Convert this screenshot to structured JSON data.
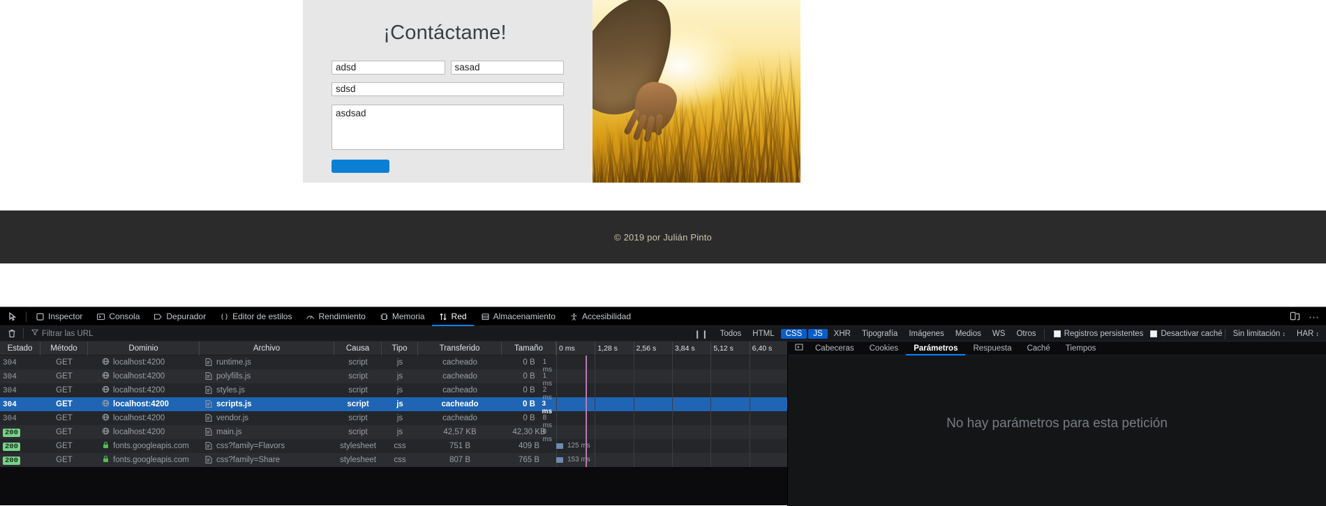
{
  "page": {
    "contact": {
      "title": "¡Contáctame!",
      "name_value": "adsd",
      "surname_value": "sasad",
      "subject_value": "sdsd",
      "message_value": "asdsad",
      "submit_label": "",
      "accent_color": "#0a7fd4",
      "card_bg": "#e7e7e7"
    },
    "footer": {
      "copyright": "© 2019 por Julián Pinto"
    }
  },
  "devtools": {
    "tabs": [
      {
        "label": "Inspector",
        "icon": "inspector-icon",
        "active": false
      },
      {
        "label": "Consola",
        "icon": "console-icon",
        "active": false
      },
      {
        "label": "Depurador",
        "icon": "debugger-icon",
        "active": false
      },
      {
        "label": "Editor de estilos",
        "icon": "style-editor-icon",
        "active": false
      },
      {
        "label": "Rendimiento",
        "icon": "performance-icon",
        "active": false
      },
      {
        "label": "Memoria",
        "icon": "memory-icon",
        "active": false
      },
      {
        "label": "Red",
        "icon": "network-icon",
        "active": true
      },
      {
        "label": "Almacenamiento",
        "icon": "storage-icon",
        "active": false
      },
      {
        "label": "Accesibilidad",
        "icon": "accessibility-icon",
        "active": false
      }
    ],
    "picker_icon": "element-picker-icon",
    "responsive_icon": "responsive-design-mode-icon",
    "more_icon": "more-options-icon",
    "network": {
      "clear_icon": "trash-icon",
      "filter_icon": "filter-icon",
      "filter_placeholder": "Filtrar las URL",
      "pause_icon": "pause-icon",
      "type_filters": [
        {
          "label": "Todos",
          "selected": false
        },
        {
          "label": "HTML",
          "selected": false
        },
        {
          "label": "CSS",
          "selected": true
        },
        {
          "label": "JS",
          "selected": true
        },
        {
          "label": "XHR",
          "selected": false
        },
        {
          "label": "Tipografía",
          "selected": false
        },
        {
          "label": "Imágenes",
          "selected": false
        },
        {
          "label": "Medios",
          "selected": false
        },
        {
          "label": "WS",
          "selected": false
        },
        {
          "label": "Otros",
          "selected": false
        }
      ],
      "checkboxes": [
        {
          "label": "Registros persistentes",
          "checked": false
        },
        {
          "label": "Desactivar caché",
          "checked": false
        }
      ],
      "throttle_label": "Sin limitación",
      "har_label": "HAR",
      "columns": [
        "Estado",
        "Método",
        "Dominio",
        "Archivo",
        "Causa",
        "Tipo",
        "Transferido",
        "Tamaño"
      ],
      "timeline_ticks": [
        "0 ms",
        "1,28 s",
        "2,56 s",
        "3,84 s",
        "5,12 s",
        "6,40 s"
      ],
      "rows": [
        {
          "status": "304",
          "status_kind": "notmodified",
          "method": "GET",
          "domain": "localhost:4200",
          "domain_icon": "globe-icon",
          "file": "runtime.js",
          "cause": "script",
          "type": "js",
          "transferred": "cacheado",
          "size": "0 B",
          "time": "1 ms",
          "bar": false,
          "selected": false
        },
        {
          "status": "304",
          "status_kind": "notmodified",
          "method": "GET",
          "domain": "localhost:4200",
          "domain_icon": "globe-icon",
          "file": "polyfills.js",
          "cause": "script",
          "type": "js",
          "transferred": "cacheado",
          "size": "0 B",
          "time": "1 ms",
          "bar": false,
          "selected": false
        },
        {
          "status": "304",
          "status_kind": "notmodified",
          "method": "GET",
          "domain": "localhost:4200",
          "domain_icon": "globe-icon",
          "file": "styles.js",
          "cause": "script",
          "type": "js",
          "transferred": "cacheado",
          "size": "0 B",
          "time": "2 ms",
          "bar": false,
          "selected": false
        },
        {
          "status": "304",
          "status_kind": "notmodified",
          "method": "GET",
          "domain": "localhost:4200",
          "domain_icon": "globe-icon",
          "file": "scripts.js",
          "cause": "script",
          "type": "js",
          "transferred": "cacheado",
          "size": "0 B",
          "time": "3 ms",
          "bar": false,
          "selected": true
        },
        {
          "status": "304",
          "status_kind": "notmodified",
          "method": "GET",
          "domain": "localhost:4200",
          "domain_icon": "globe-icon",
          "file": "vendor.js",
          "cause": "script",
          "type": "js",
          "transferred": "cacheado",
          "size": "0 B",
          "time": "8 ms",
          "bar": false,
          "selected": false
        },
        {
          "status": "200",
          "status_kind": "ok",
          "method": "GET",
          "domain": "localhost:4200",
          "domain_icon": "globe-icon",
          "file": "main.js",
          "cause": "script",
          "type": "js",
          "transferred": "42,57 KB",
          "size": "42,30 KB",
          "time": "8 ms",
          "bar": false,
          "selected": false
        },
        {
          "status": "200",
          "status_kind": "ok",
          "method": "GET",
          "domain": "fonts.googleapis.com",
          "domain_icon": "lock-icon",
          "file": "css?family=Flavors",
          "cause": "stylesheet",
          "type": "css",
          "transferred": "751 B",
          "size": "409 B",
          "time": "125 ms",
          "bar": true,
          "selected": false
        },
        {
          "status": "200",
          "status_kind": "ok",
          "method": "GET",
          "domain": "fonts.googleapis.com",
          "domain_icon": "lock-icon",
          "file": "css?family=Share",
          "cause": "stylesheet",
          "type": "css",
          "transferred": "807 B",
          "size": "765 B",
          "time": "153 ms",
          "bar": true,
          "selected": false
        }
      ],
      "details": {
        "expand_icon": "expand-panel-icon",
        "tabs": [
          {
            "label": "Cabeceras",
            "active": false
          },
          {
            "label": "Cookies",
            "active": false
          },
          {
            "label": "Parámetros",
            "active": true
          },
          {
            "label": "Respuesta",
            "active": false
          },
          {
            "label": "Caché",
            "active": false
          },
          {
            "label": "Tiempos",
            "active": false
          }
        ],
        "empty_message": "No hay parámetros para esta petición"
      }
    }
  }
}
